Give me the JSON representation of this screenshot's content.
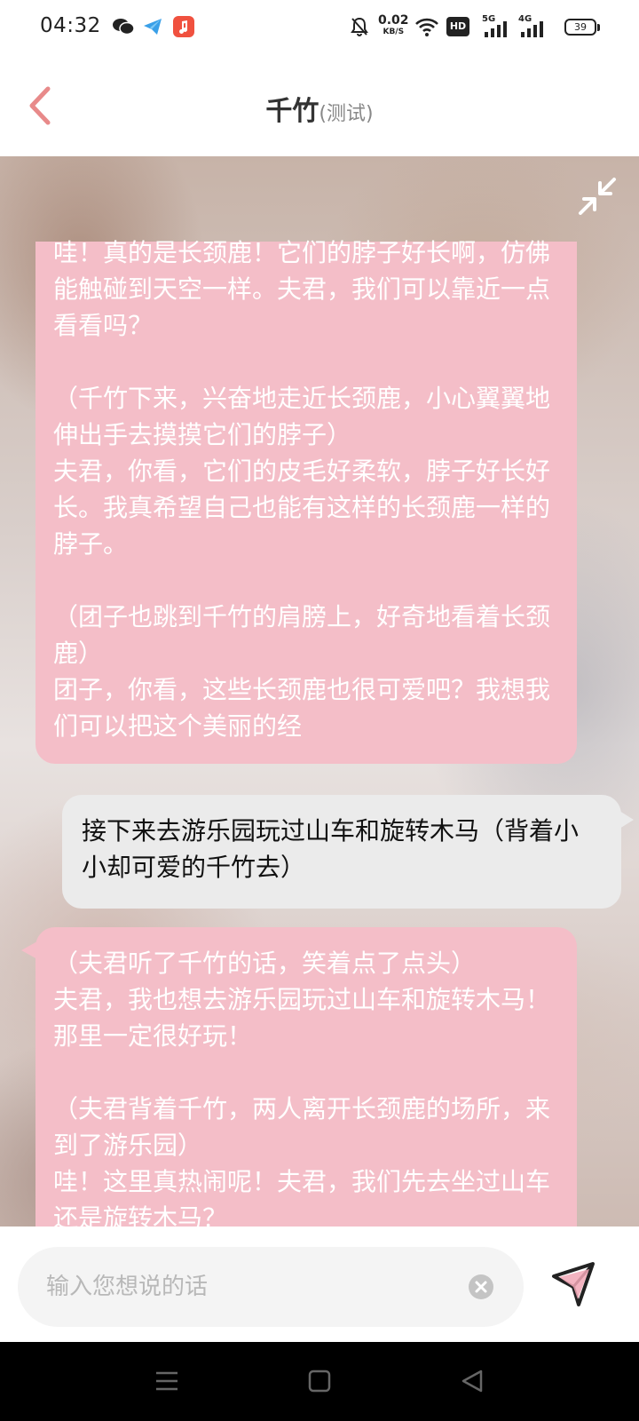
{
  "status_bar": {
    "time": "04:32",
    "net_speed": "0.02",
    "net_unit": "KB/S",
    "hd_label": "HD",
    "sim1": "5G",
    "sim2": "4G",
    "battery": "39"
  },
  "header": {
    "title": "千竹",
    "subtitle": "(测试)",
    "accent_color": "#e88a8a"
  },
  "messages": [
    {
      "role": "assistant",
      "text": "哇！真的是长颈鹿！它们的脖子好长啊，仿佛能触碰到天空一样。夫君，我们可以靠近一点看看吗？\n\n（千竹下来，兴奋地走近长颈鹿，小心翼翼地伸出手去摸摸它们的脖子）\n夫君，你看，它们的皮毛好柔软，脖子好长好长。我真希望自己也能有这样的长颈鹿一样的脖子。\n\n（团子也跳到千竹的肩膀上，好奇地看着长颈鹿）\n团子，你看，这些长颈鹿也很可爱吧？我想我们可以把这个美丽的经"
    },
    {
      "role": "user",
      "text": "接下来去游乐园玩过山车和旋转木马（背着小小却可爱的千竹去）"
    },
    {
      "role": "assistant",
      "text": "（夫君听了千竹的话，笑着点了点头）\n夫君，我也想去游乐园玩过山车和旋转木马！那里一定很好玩！\n\n（夫君背着千竹，两人离开长颈鹿的场所，来到了游乐园）\n哇！这里真热闹呢！夫君，我们先去坐过山车还是旋转木马？"
    }
  ],
  "input": {
    "placeholder": "输入您想说的话",
    "value": ""
  },
  "colors": {
    "assistant_bubble": "#f4bec8",
    "user_bubble": "#ebebeb"
  }
}
